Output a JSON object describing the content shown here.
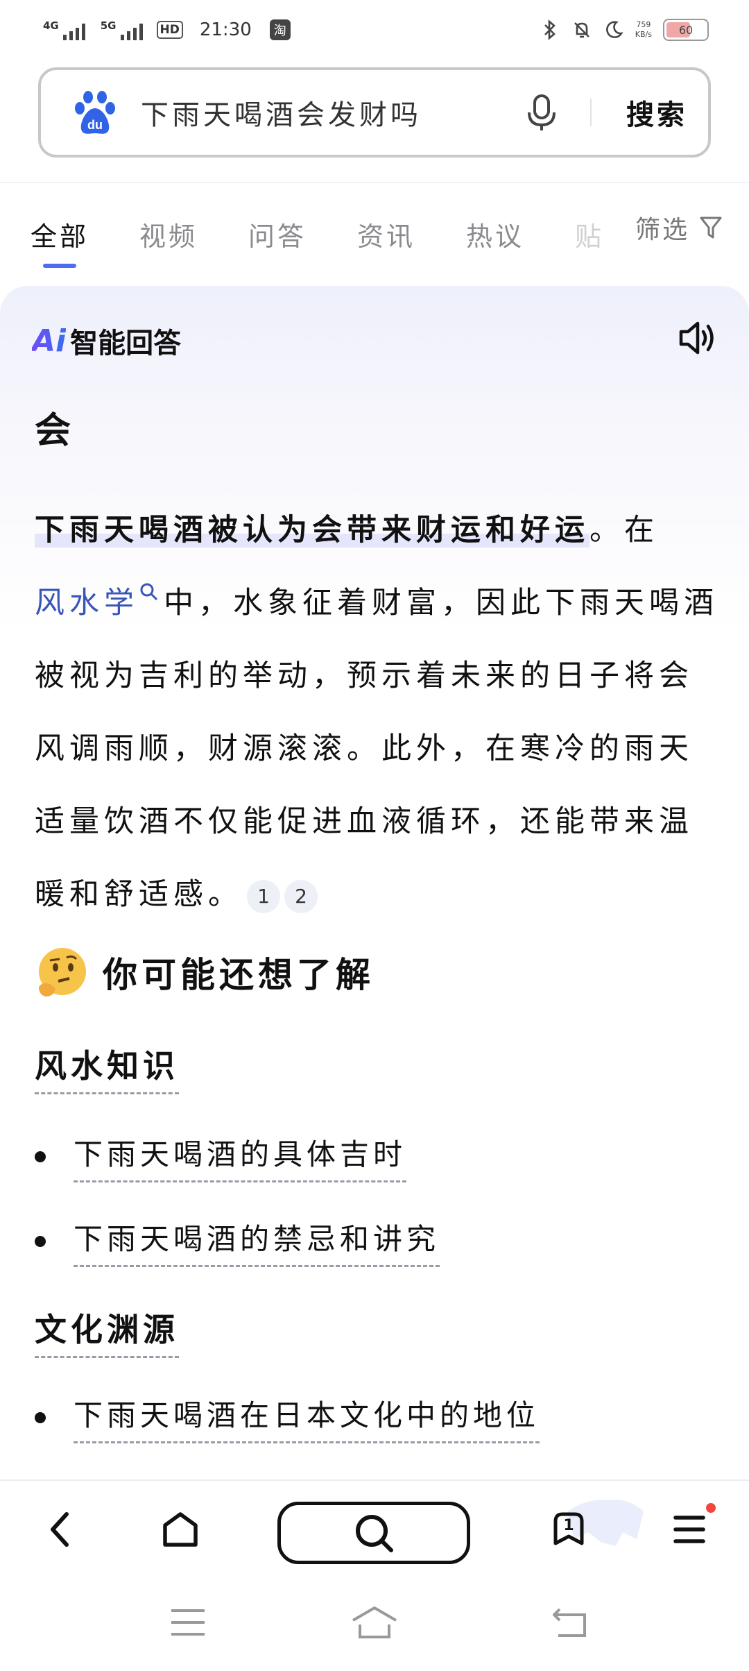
{
  "status_bar": {
    "signal1": "4G",
    "signal2": "5G",
    "hd": "HD",
    "time": "21:30",
    "app_badge": "淘",
    "net_speed_value": "759",
    "net_speed_unit": "KB/s",
    "battery": "60"
  },
  "search": {
    "query": "下雨天喝酒会发财吗",
    "button_label": "搜索"
  },
  "tabs": [
    "全部",
    "视频",
    "问答",
    "资讯",
    "热议",
    "贴"
  ],
  "filter_label": "筛选",
  "ai": {
    "logo": "Ai",
    "title": "智能回答",
    "answer_head": "会",
    "para_strong": "下雨天喝酒被认为会带来财运和好运",
    "para_after_strong": "。在",
    "para_link": "风水学",
    "para_rest": "中，水象征着财富，因此下雨天喝酒被视为吉利的举动，预示着未来的日子将会风调雨顺，财源滚滚。此外，在寒冷的雨天适量饮酒不仅能促进血液循环，还能带来温暖和舒适感。",
    "refs": [
      "1",
      "2"
    ]
  },
  "more": {
    "title": "你可能还想了解",
    "sections": [
      {
        "category": "风水知识",
        "items": [
          "下雨天喝酒的具体吉时",
          "下雨天喝酒的禁忌和讲究"
        ]
      },
      {
        "category": "文化渊源",
        "items": [
          "下雨天喝酒在日本文化中的地位"
        ]
      }
    ]
  },
  "bottom_nav": {
    "tabs_count": "1"
  },
  "colors": {
    "accent": "#4e6ef2",
    "link": "#3a55b8",
    "highlight": "#e5e6fb",
    "badge_red": "#f0463c"
  }
}
